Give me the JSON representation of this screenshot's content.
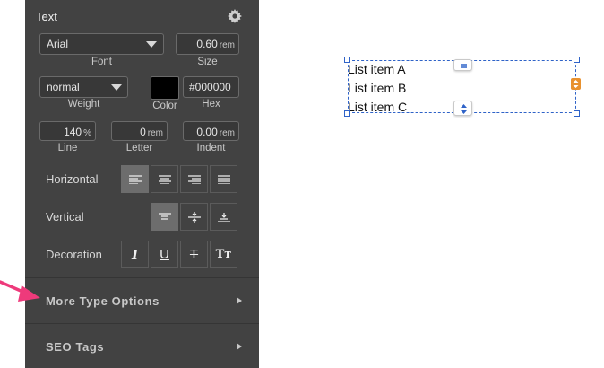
{
  "panel": {
    "title": "Text",
    "font": {
      "value": "Arial",
      "label": "Font"
    },
    "size": {
      "value": "0.60",
      "unit": "rem",
      "label": "Size"
    },
    "weight": {
      "value": "normal",
      "label": "Weight"
    },
    "color": {
      "label": "Color",
      "swatch": "#000000"
    },
    "hex": {
      "value": "#000000",
      "label": "Hex"
    },
    "line": {
      "value": "140",
      "unit": "%",
      "label": "Line"
    },
    "letter": {
      "value": "0",
      "unit": "rem",
      "label": "Letter"
    },
    "indent": {
      "value": "0.00",
      "unit": "rem",
      "label": "Indent"
    },
    "horizontal_label": "Horizontal",
    "vertical_label": "Vertical",
    "decoration_label": "Decoration",
    "decoration_buttons": {
      "italic": "I",
      "underline": "U",
      "strike": "T",
      "tt": "Tт"
    },
    "sections": {
      "more_type": "More Type Options",
      "seo": "SEO Tags"
    }
  },
  "canvas": {
    "items": [
      "List item A",
      "List item B",
      "List item C"
    ]
  },
  "colors": {
    "panel_bg": "#424242",
    "accent_blue": "#2f63c8",
    "accent_orange": "#e8912f",
    "arrow_pink": "#ee3a7b"
  }
}
